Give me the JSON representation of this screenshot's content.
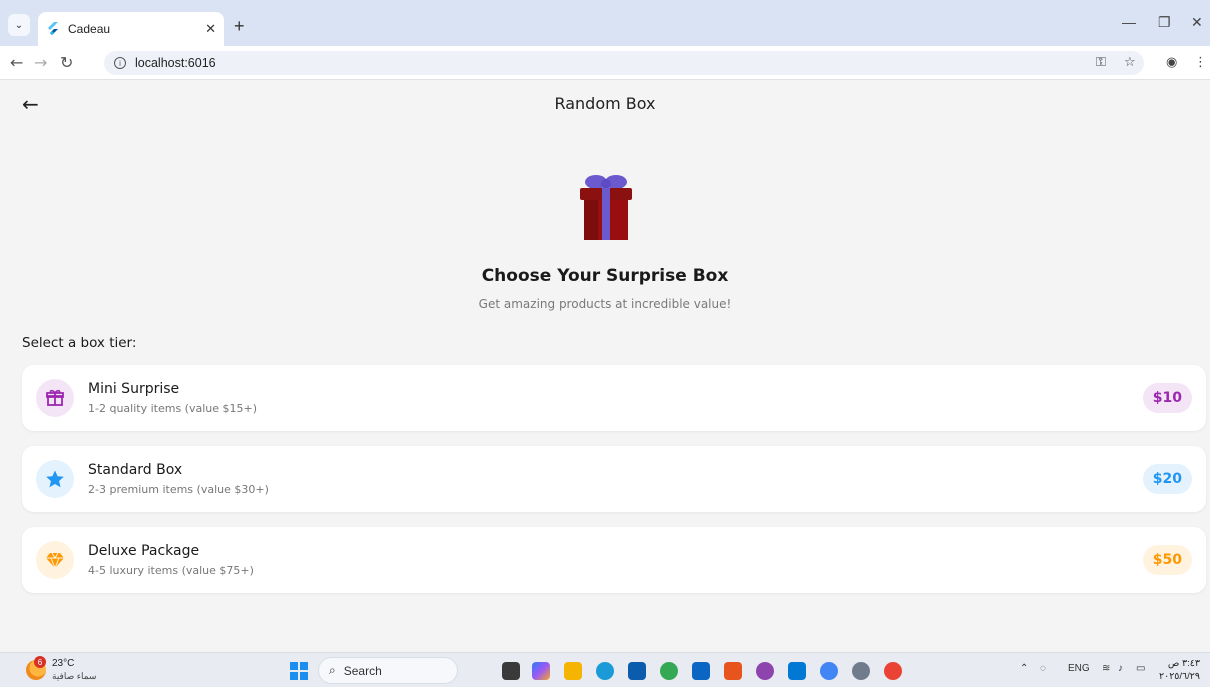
{
  "browser": {
    "tab_title": "Cadeau",
    "url": "localhost:6016"
  },
  "app": {
    "title": "Random Box",
    "headline": "Choose Your Surprise Box",
    "subline": "Get amazing products at incredible value!",
    "section_label": "Select a box tier:",
    "tiers": [
      {
        "name": "Mini Surprise",
        "desc": "1-2 quality items (value $15+)",
        "price": "$10",
        "icon": "gift-box-icon",
        "accent": "#9c27b0",
        "tint": "#f3e5f5"
      },
      {
        "name": "Standard Box",
        "desc": "2-3 premium items (value $30+)",
        "price": "$20",
        "icon": "star-icon",
        "accent": "#2196f3",
        "tint": "#e3f2fd"
      },
      {
        "name": "Deluxe Package",
        "desc": "4-5 luxury items (value $75+)",
        "price": "$50",
        "icon": "diamond-icon",
        "accent": "#ff9800",
        "tint": "#fff3e0"
      }
    ]
  },
  "taskbar": {
    "weather_temp": "23°C",
    "weather_cond": "سماء صافية",
    "weather_badge": "6",
    "search_label": "Search",
    "lang": "ENG",
    "time": "٣:٤٣ ص",
    "date": "٢٠٢٥/٦/٢٩"
  },
  "colors": {
    "background": "#f4f4f4",
    "card": "#ffffff",
    "chrome_tabbar": "#dae3f4"
  }
}
